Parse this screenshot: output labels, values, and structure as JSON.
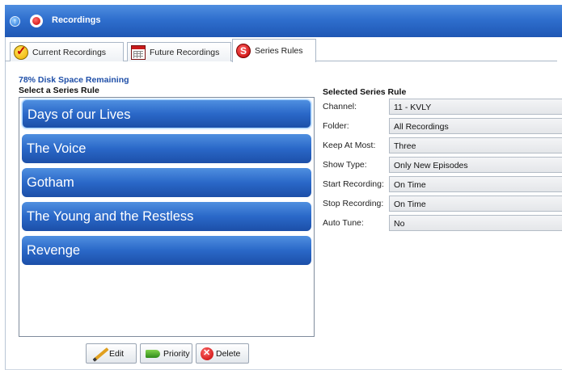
{
  "window": {
    "title": "Recordings"
  },
  "tabs": [
    {
      "label": "Current Recordings"
    },
    {
      "label": "Future Recordings"
    },
    {
      "label": "Series Rules"
    }
  ],
  "disk_space": "78% Disk Space Remaining",
  "select_label": "Select a Series Rule",
  "series": [
    {
      "label": "Days of our Lives"
    },
    {
      "label": "The Voice"
    },
    {
      "label": "Gotham"
    },
    {
      "label": "The Young and the Restless"
    },
    {
      "label": "Revenge"
    }
  ],
  "buttons": {
    "edit": "Edit",
    "priority": "Priority",
    "delete": "Delete"
  },
  "rule": {
    "title": "Selected Series Rule",
    "fields": [
      {
        "label": "Channel:",
        "value": "11 - KVLY"
      },
      {
        "label": "Folder:",
        "value": "All Recordings"
      },
      {
        "label": "Keep At Most:",
        "value": "Three"
      },
      {
        "label": "Show Type:",
        "value": "Only New Episodes"
      },
      {
        "label": "Start Recording:",
        "value": "On Time"
      },
      {
        "label": "Stop Recording:",
        "value": "On Time"
      },
      {
        "label": "Auto Tune:",
        "value": "No"
      }
    ]
  },
  "colors": {
    "titlebar": "#2f6fce",
    "list_item": "#2a68c8",
    "disk_text": "#1f4fa8"
  }
}
